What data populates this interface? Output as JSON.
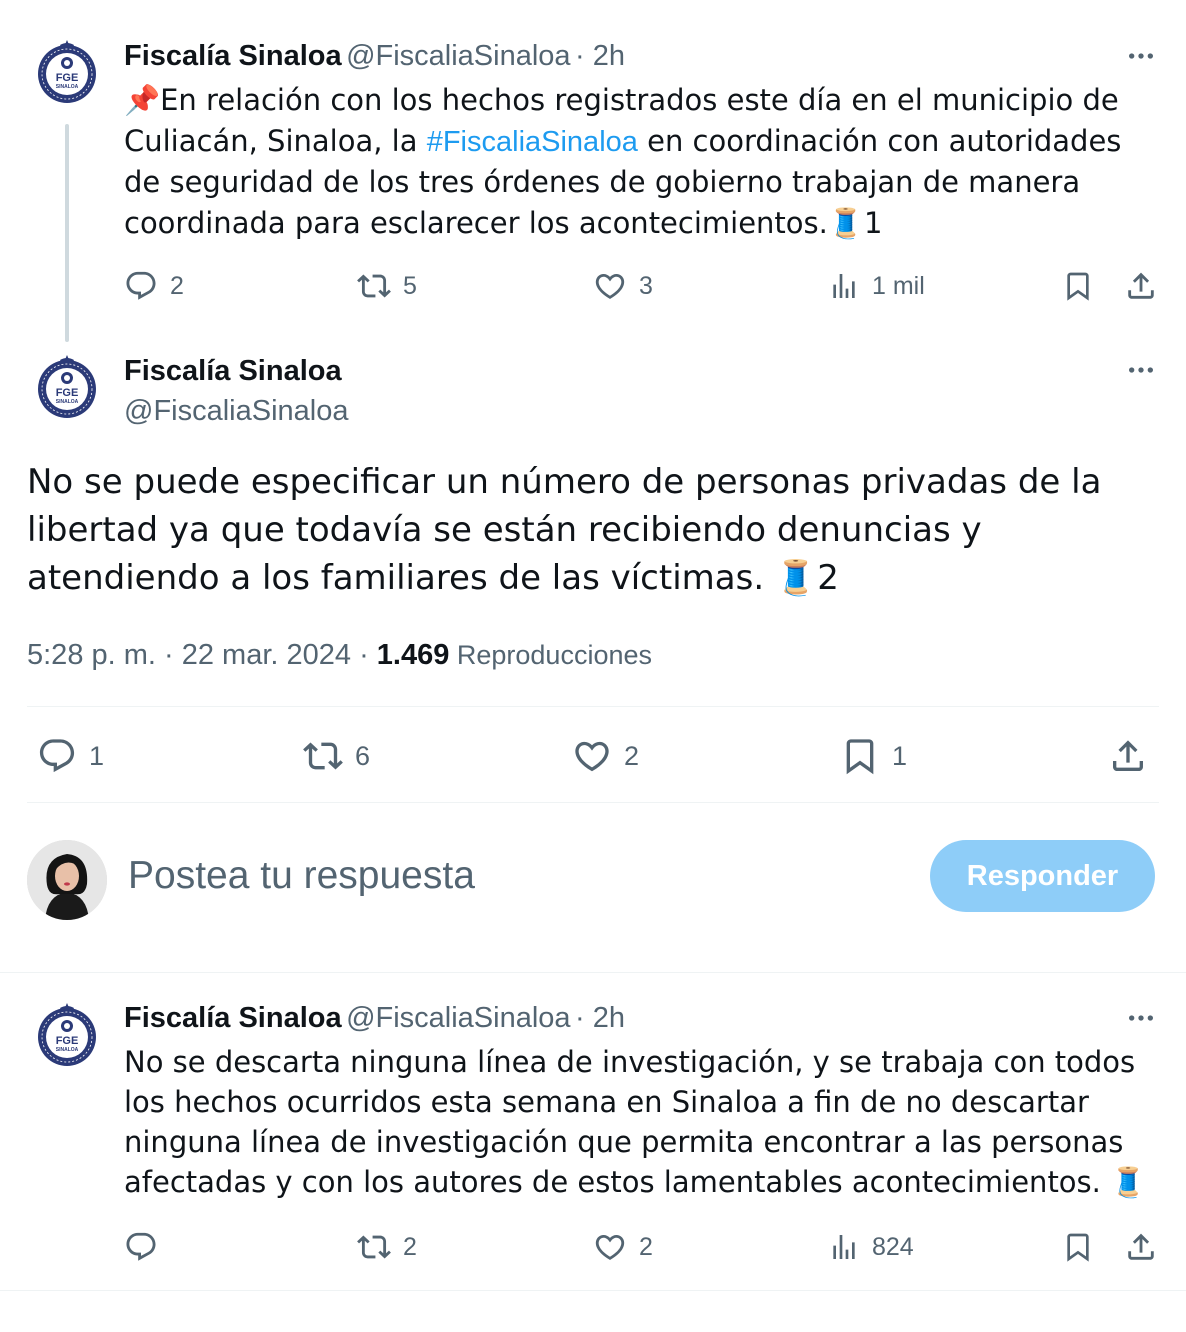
{
  "colors": {
    "accent": "#1d9bf0",
    "muted": "#536471",
    "text": "#0f1419",
    "reply_button_bg": "#8ecdf8",
    "thread_line": "#cfd9de"
  },
  "avatar": {
    "logo_text": "FGE",
    "logo_subtext": "SINALOA",
    "ring_text": "FISCALÍA GENERAL DEL ESTADO"
  },
  "tweet1": {
    "name": "Fiscalía Sinaloa",
    "handle": "@FiscaliaSinaloa",
    "time": "· 2h",
    "icon": "pushpin-emoji",
    "text_before": "📌En relación con los hechos registrados este día en el municipio de Culiacán, Sinaloa, la ",
    "hashtag": "#FiscaliaSinaloa",
    "text_after": " en coordinación con autoridades de seguridad de los tres órdenes de gobierno trabajan de manera coordinada para esclarecer los acontecimientos.🧵1",
    "replies": "2",
    "reposts": "5",
    "likes": "3",
    "views": "1 mil"
  },
  "main_tweet": {
    "name": "Fiscalía Sinaloa",
    "handle": "@FiscaliaSinaloa",
    "text": "No se puede especificar un número de personas privadas de la libertad ya que  todavía se están recibiendo denuncias y atendiendo a los familiares de las víctimas. 🧵2",
    "timestamp": "5:28 p. m. · 22 mar. 2024 · ",
    "view_count": "1.469",
    "views_label": " Reproducciones",
    "replies": "1",
    "reposts": "6",
    "likes": "2",
    "bookmarks": "1"
  },
  "reply_box": {
    "placeholder": "Postea tu respuesta",
    "button_label": "Responder"
  },
  "tweet3": {
    "name": "Fiscalía Sinaloa",
    "handle": "@FiscaliaSinaloa",
    "time": "· 2h",
    "text": "No se descarta ninguna línea de investigación, y se trabaja con todos los hechos ocurridos esta semana en Sinaloa a fin de no descartar ninguna línea de investigación que permita encontrar a las personas afectadas y con los autores de estos lamentables acontecimientos. 🧵",
    "replies": "",
    "reposts": "2",
    "likes": "2",
    "views": "824"
  }
}
